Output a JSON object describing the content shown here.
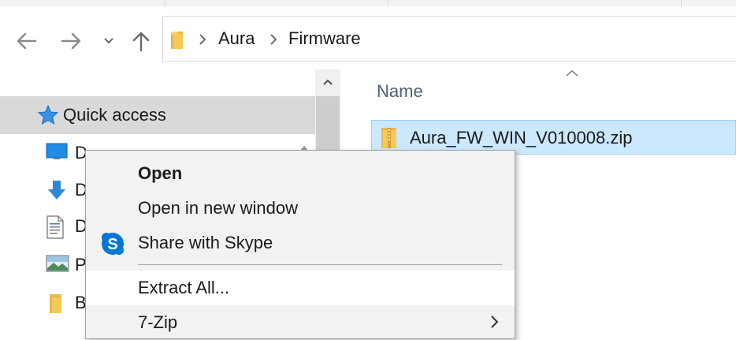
{
  "window": {
    "nav": {
      "back_icon": "arrow-left-icon",
      "forward_icon": "arrow-right-icon",
      "recent_icon": "chevron-down-icon",
      "up_icon": "arrow-up-icon"
    },
    "address": {
      "crumbs": [
        "Aura",
        "Firmware"
      ]
    }
  },
  "navigation_pane": {
    "quick_access": "Quick access",
    "items": [
      {
        "label": "Desktop",
        "visible_label": "D",
        "icon": "desktop-icon"
      },
      {
        "label": "Downloads",
        "visible_label": "D",
        "icon": "download-icon"
      },
      {
        "label": "Documents",
        "visible_label": "D",
        "icon": "document-icon"
      },
      {
        "label": "Pictures",
        "visible_label": "P",
        "icon": "pictures-icon"
      },
      {
        "label": "B",
        "visible_label": "B",
        "icon": "folder-icon"
      }
    ]
  },
  "file_list": {
    "column_header": "Name",
    "files": [
      {
        "name": "Aura_FW_WIN_V010008.zip",
        "icon": "zip-folder-icon",
        "selected": true
      }
    ]
  },
  "context_menu": {
    "items": [
      {
        "label": "Open",
        "bold": true
      },
      {
        "label": "Open in new window"
      },
      {
        "label": "Share with Skype",
        "icon": "skype-icon"
      },
      {
        "label": "Extract All...",
        "highlighted": true
      },
      {
        "label": "7-Zip",
        "submenu": true
      }
    ]
  },
  "colors": {
    "selection": "#cce8ff",
    "selection_border": "#99d1ff",
    "header_text": "#4c607a",
    "quick_access_bg": "#d9d9d9",
    "menu_bg": "#f2f2f2",
    "skype_blue": "#0078d4"
  }
}
